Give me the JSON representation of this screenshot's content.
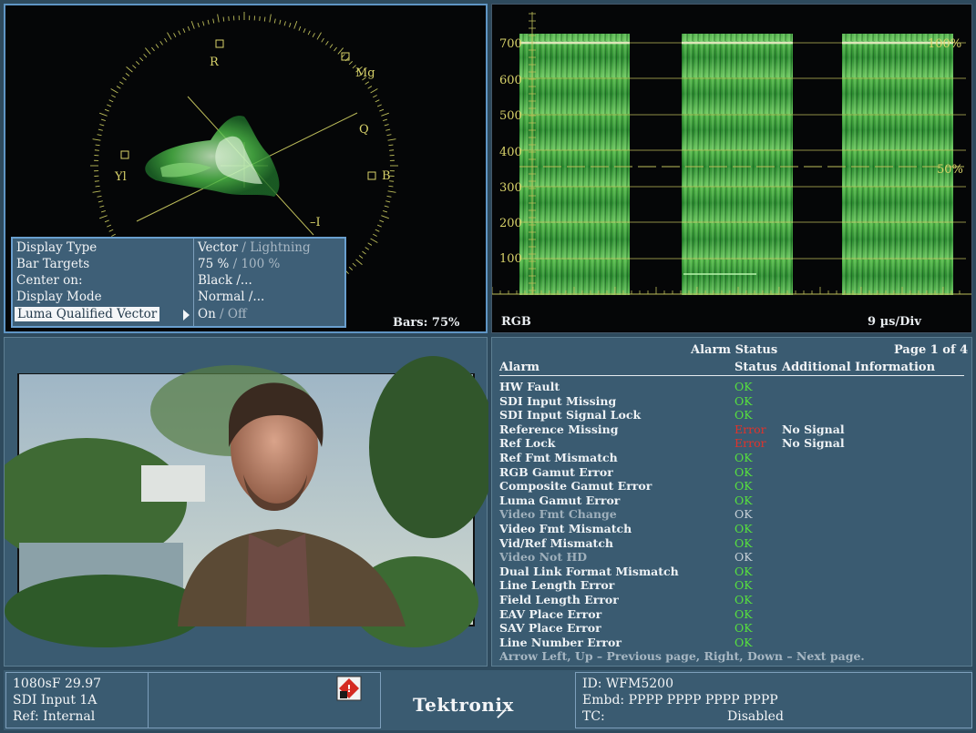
{
  "vector_panel": {
    "axis_labels": {
      "r": "R",
      "mg": "Mg",
      "yl": "Yl",
      "b": "B",
      "q": "Q",
      "neg_i": "–I"
    },
    "bars_label": "Bars: 75%"
  },
  "settings_menu": {
    "items": [
      {
        "label": "Display Type",
        "value_active": "Vector",
        "value_rest": " / Lightning"
      },
      {
        "label": "Bar Targets",
        "value_active": "75 %",
        "value_rest": " / 100 %"
      },
      {
        "label": "Center on:",
        "value_active": "Black /...",
        "value_rest": ""
      },
      {
        "label": "Display Mode",
        "value_active": "Normal /...",
        "value_rest": ""
      },
      {
        "label": "Luma Qualified Vector",
        "value_active": "On",
        "value_rest": " / Off"
      }
    ]
  },
  "waveform_panel": {
    "y_ticks": [
      "700",
      "600",
      "500",
      "400",
      "300",
      "200",
      "100"
    ],
    "pct_100": "100%",
    "pct_50": "50%",
    "mode_label": "RGB",
    "timebase_label": "9 µs/Div"
  },
  "alarm_panel": {
    "title": "Alarm Status",
    "page": "Page 1 of 4",
    "col_alarm": "Alarm",
    "col_status": "Status",
    "col_info": "Additional Information",
    "rows": [
      {
        "name": "HW Fault",
        "status": "OK",
        "info": ""
      },
      {
        "name": "SDI Input Missing",
        "status": "OK",
        "info": ""
      },
      {
        "name": "SDI Input Signal Lock",
        "status": "OK",
        "info": ""
      },
      {
        "name": "Reference Missing",
        "status": "Error",
        "info": "No Signal"
      },
      {
        "name": "Ref Lock",
        "status": "Error",
        "info": "No Signal"
      },
      {
        "name": "Ref Fmt Mismatch",
        "status": "OK",
        "info": ""
      },
      {
        "name": "RGB Gamut Error",
        "status": "OK",
        "info": ""
      },
      {
        "name": "Composite Gamut Error",
        "status": "OK",
        "info": ""
      },
      {
        "name": "Luma Gamut Error",
        "status": "OK",
        "info": ""
      },
      {
        "name": "Video Fmt Change",
        "status": "OK",
        "info": ""
      },
      {
        "name": "Video Fmt Mismatch",
        "status": "OK",
        "info": ""
      },
      {
        "name": "Vid/Ref Mismatch",
        "status": "OK",
        "info": ""
      },
      {
        "name": "Video Not HD",
        "status": "OK",
        "info": ""
      },
      {
        "name": "Dual Link Format Mismatch",
        "status": "OK",
        "info": ""
      },
      {
        "name": "Line Length Error",
        "status": "OK",
        "info": ""
      },
      {
        "name": "Field Length Error",
        "status": "OK",
        "info": ""
      },
      {
        "name": "EAV Place Error",
        "status": "OK",
        "info": ""
      },
      {
        "name": "SAV Place Error",
        "status": "OK",
        "info": ""
      },
      {
        "name": "Line Number Error",
        "status": "OK",
        "info": ""
      }
    ],
    "footer": "Arrow Left, Up – Previous page, Right, Down – Next page."
  },
  "status_bar": {
    "format": "1080sF 29.97",
    "input": "SDI Input 1A",
    "ref": "Ref: Internal",
    "brand": "Tektronix",
    "id": "ID: WFM5200",
    "embd": "Embd: PPPP PPPP PPPP PPPP",
    "tc_label": "TC:",
    "tc_value": "Disabled"
  }
}
